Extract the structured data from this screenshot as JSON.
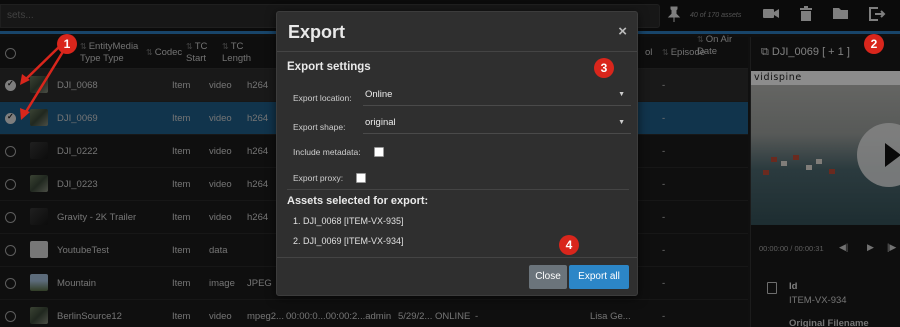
{
  "toolbar": {
    "search_placeholder": "sets...",
    "asset_count": "40 of 170 assets",
    "icons": [
      "pin-icon",
      "video-camera-icon",
      "trash-icon",
      "folder-open-icon",
      "export-icon"
    ]
  },
  "table": {
    "headers": {
      "entity_media_type": "EntityMedia Type Type",
      "codec": "Codec",
      "tc_start": "TC Start",
      "tc_length": "TC Length",
      "episode": "Episode",
      "on_air_date": "On Air Date",
      "col_partial": "ol"
    },
    "rows": [
      {
        "name": "DJI_0068",
        "entity": "Item",
        "media": "video",
        "codec": "h264",
        "extra": "-",
        "state": "selected"
      },
      {
        "name": "DJI_0069",
        "entity": "Item",
        "media": "video",
        "codec": "h264",
        "extra": "-",
        "state": "active"
      },
      {
        "name": "DJI_0222",
        "entity": "Item",
        "media": "video",
        "codec": "h264",
        "extra": "-",
        "state": ""
      },
      {
        "name": "DJI_0223",
        "entity": "Item",
        "media": "video",
        "codec": "h264",
        "extra": "-",
        "state": ""
      },
      {
        "name": "Gravity - 2K Trailer",
        "entity": "Item",
        "media": "video",
        "codec": "h264",
        "extra": "-",
        "state": ""
      },
      {
        "name": "YoutubeTest",
        "entity": "Item",
        "media": "data",
        "codec": "",
        "extra": "-",
        "state": ""
      },
      {
        "name": "Mountain",
        "entity": "Item",
        "media": "image",
        "codec": "JPEG",
        "extra": "-",
        "state": ""
      },
      {
        "name": "BerlinSource12",
        "entity": "Item",
        "media": "video",
        "codec": "mpeg2...",
        "extra": "-",
        "state": ""
      }
    ],
    "last_row_tail": {
      "tc": "00:00:0...00:00:2...admin",
      "date_status": "5/29/2... ONLINE",
      "owner": "Lisa Ge...",
      "dash": "-"
    }
  },
  "panel": {
    "title": "DJI_0069 [ + 1 ]",
    "logo": "vidispine",
    "time": "00:00:00 / 00:00:31",
    "id_label": "Id",
    "id_value": "ITEM-VX-934",
    "original_filename_label": "Original Filename"
  },
  "modal": {
    "title": "Export",
    "close_glyph": "×",
    "section_title": "Export settings",
    "location_label": "Export location:",
    "location_value": "Online",
    "shape_label": "Export shape:",
    "shape_value": "original",
    "metadata_label": "Include metadata:",
    "proxy_label": "Export proxy:",
    "assets_title": "Assets selected for export:",
    "assets": [
      "1. DJI_0068 [ITEM-VX-935]",
      "2. DJI_0069 [ITEM-VX-934]"
    ],
    "close_button": "Close",
    "export_button": "Export all"
  },
  "callouts": [
    "1",
    "2",
    "3",
    "4"
  ],
  "colors": {
    "accent": "#2c86c7",
    "callout": "#d9261c",
    "active_row": "#1f5f8b"
  }
}
